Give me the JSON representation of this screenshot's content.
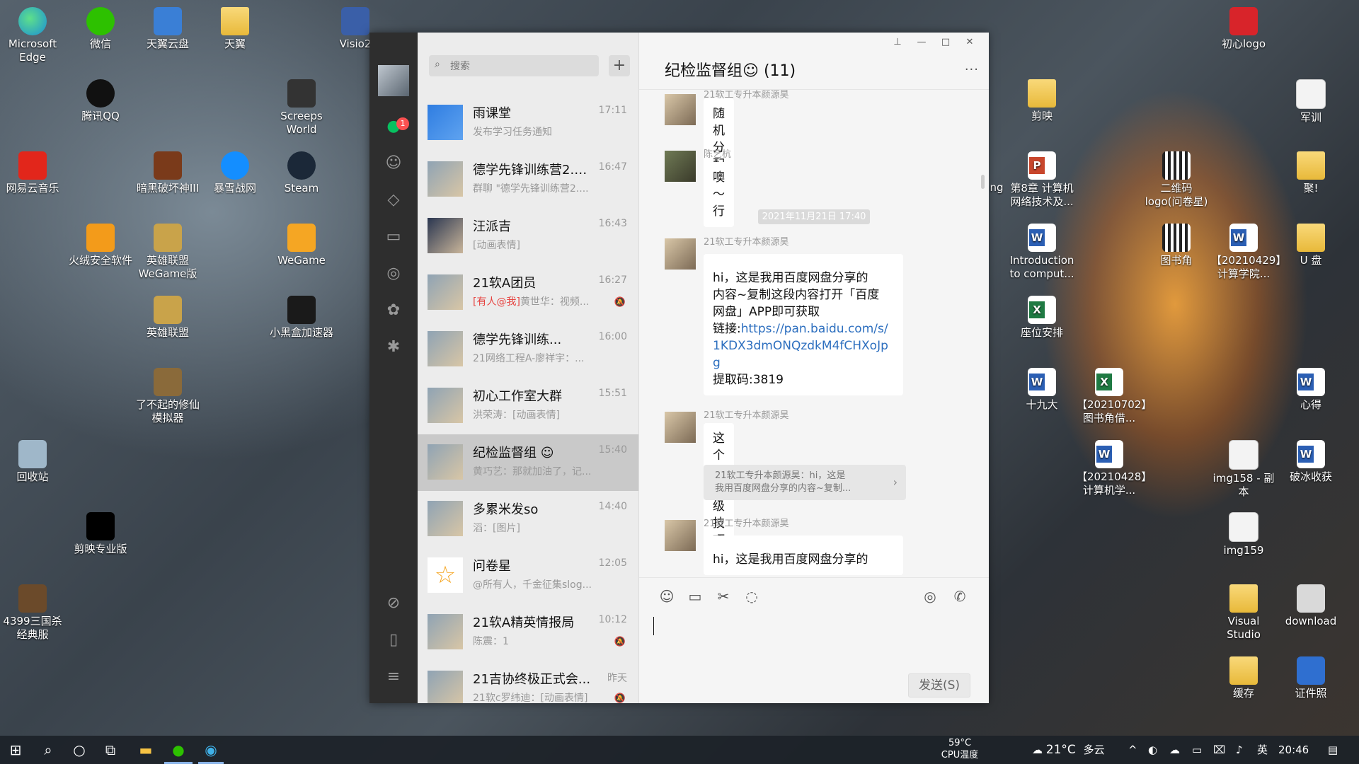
{
  "desktop": {
    "icons": [
      {
        "label": "Microsoft\nEdge",
        "type": "app",
        "color": "#2f9be3"
      },
      {
        "label": "微信",
        "type": "app",
        "color": "#2dc100"
      },
      {
        "label": "天翼云盘",
        "type": "app",
        "color": "#3a7fd6"
      },
      {
        "label": "天翼",
        "type": "folder"
      },
      {
        "label": "Visio2",
        "type": "app",
        "color": "#3a5fa8"
      },
      {
        "label": "腾讯QQ",
        "type": "app",
        "color": "#111111"
      },
      {
        "label": "Screeps World",
        "type": "app",
        "color": "#333333"
      },
      {
        "label": "网易云音乐",
        "type": "app",
        "color": "#e2261b"
      },
      {
        "label": "暗黑破坏神III",
        "type": "app",
        "color": "#7a3a1a"
      },
      {
        "label": "暴雪战网",
        "type": "app",
        "color": "#148eff"
      },
      {
        "label": "Steam",
        "type": "app",
        "color": "#1b2838"
      },
      {
        "label": "火绒安全软件",
        "type": "app",
        "color": "#f39b1a"
      },
      {
        "label": "英雄联盟 WeGame版",
        "type": "app",
        "color": "#c9a34a"
      },
      {
        "label": "WeGame",
        "type": "app",
        "color": "#f5a623"
      },
      {
        "label": "英雄联盟",
        "type": "app",
        "color": "#c9a34a"
      },
      {
        "label": "小黑盒加速器",
        "type": "app",
        "color": "#1a1a1a"
      },
      {
        "label": "了不起的修仙模拟器",
        "type": "app",
        "color": "#8a6a3a"
      },
      {
        "label": "回收站",
        "type": "app",
        "color": "#9fb7c9"
      },
      {
        "label": "剪映专业版",
        "type": "app",
        "color": "#000000"
      },
      {
        "label": "4399三国杀经典服",
        "type": "app",
        "color": "#6b4a2a"
      },
      {
        "label": "初心logo",
        "type": "app",
        "color": "#d8242a"
      },
      {
        "label": "剪映",
        "type": "folder"
      },
      {
        "label": "军训",
        "type": "doc"
      },
      {
        "label": "第8章 计算机网络技术及...",
        "type": "ppt"
      },
      {
        "label": "二维码logo(问卷星)",
        "type": "qr"
      },
      {
        "label": "聚!",
        "type": "folder"
      },
      {
        "label": "Introduction to comput...",
        "type": "word"
      },
      {
        "label": "图书角",
        "type": "qr"
      },
      {
        "label": "【20210429】计算学院...",
        "type": "word"
      },
      {
        "label": "U 盘",
        "type": "folder"
      },
      {
        "label": "座位安排",
        "type": "excel"
      },
      {
        "label": "十九大",
        "type": "word"
      },
      {
        "label": "【20210702】图书角借...",
        "type": "excel"
      },
      {
        "label": "心得",
        "type": "word"
      },
      {
        "label": "【20210428】计算机学...",
        "type": "word"
      },
      {
        "label": "img158 - 副本",
        "type": "doc"
      },
      {
        "label": "破冰收获",
        "type": "word"
      },
      {
        "label": "img159",
        "type": "doc"
      },
      {
        "label": "Visual Studio",
        "type": "folder"
      },
      {
        "label": "download",
        "type": "app",
        "color": "#d9d9d9"
      },
      {
        "label": "缓存",
        "type": "folder"
      },
      {
        "label": "证件照",
        "type": "app",
        "color": "#2f6fd0"
      },
      {
        "label": "ng",
        "type": "text"
      }
    ]
  },
  "wechat": {
    "nav": {
      "unread": "1"
    },
    "search": {
      "placeholder": "搜索"
    },
    "chats": [
      {
        "name": "雨课堂",
        "time": "17:11",
        "preview": "发布学习任务通知",
        "mention": "",
        "muted": false
      },
      {
        "name": "德学先锋训练营2.0...",
        "time": "16:47",
        "preview": "群聊 \"德学先锋训练营2....",
        "mention": "",
        "muted": false
      },
      {
        "name": "汪派吉",
        "time": "16:43",
        "preview": "[动画表情]",
        "mention": "",
        "muted": false
      },
      {
        "name": "21软A团员",
        "time": "16:27",
        "preview": "黄世华：视频...",
        "mention": "[有人@我]",
        "muted": true
      },
      {
        "name": "德学先锋训练...",
        "time": "16:00",
        "preview": "21网络工程A-廖祥宇：...",
        "mention": "",
        "muted": false
      },
      {
        "name": "初心工作室大群",
        "time": "15:51",
        "preview": "洪荣涛：[动画表情]",
        "mention": "",
        "muted": false
      },
      {
        "name": "纪检监督组",
        "time": "15:40",
        "preview": "黄巧艺：那就加油了，记...",
        "mention": "",
        "muted": false
      },
      {
        "name": "多累米发so",
        "time": "14:40",
        "preview": "滔：[图片]",
        "mention": "",
        "muted": false
      },
      {
        "name": "问卷星",
        "time": "12:05",
        "preview": "@所有人，千金征集slog...",
        "mention": "",
        "muted": false
      },
      {
        "name": "21软A精英情报局",
        "time": "10:12",
        "preview": "陈震：1",
        "mention": "",
        "muted": true
      },
      {
        "name": "21吉协终极正式会...",
        "time": "昨天",
        "preview": "21软c罗纬迪：[动画表情]",
        "mention": "",
        "muted": true
      }
    ],
    "active_chat": {
      "title": "纪检监督组",
      "member_count": "(11)",
      "messages": [
        {
          "sender": "21软工专升本颜源昊",
          "text": "随机分配的"
        },
        {
          "sender": "陈艺杭",
          "text": "噢～行"
        },
        {
          "timestamp": "2021年11月21日 17:40"
        },
        {
          "sender": "21软工专升本颜源昊",
          "text_lines": [
            "hi，这是我用百度网盘分享的",
            "内容~复制这段内容打开「百度",
            "网盘」APP即可获取",
            "链接:"
          ],
          "link": "https://pan.baidu.com/s/1KDX3dmONQzdkM4fCHXoJpg",
          "code": "提取码:3819"
        },
        {
          "sender": "21软工专升本颜源昊",
          "text": "这个是四级技巧的"
        },
        {
          "quote_line1": "21软工专升本颜源昊：hi，这是",
          "quote_line2": "我用百度网盘分享的内容~复制..."
        },
        {
          "sender": "21软工专升本颜源昊",
          "text": "hi，这是我用百度网盘分享的"
        }
      ]
    },
    "send_label": "发送(S)"
  },
  "taskbar": {
    "cpu_temp": "59°C",
    "cpu_label": "CPU温度",
    "weather": "21°C",
    "weather_desc": "多云",
    "ime": "英",
    "clock": "20:46"
  }
}
